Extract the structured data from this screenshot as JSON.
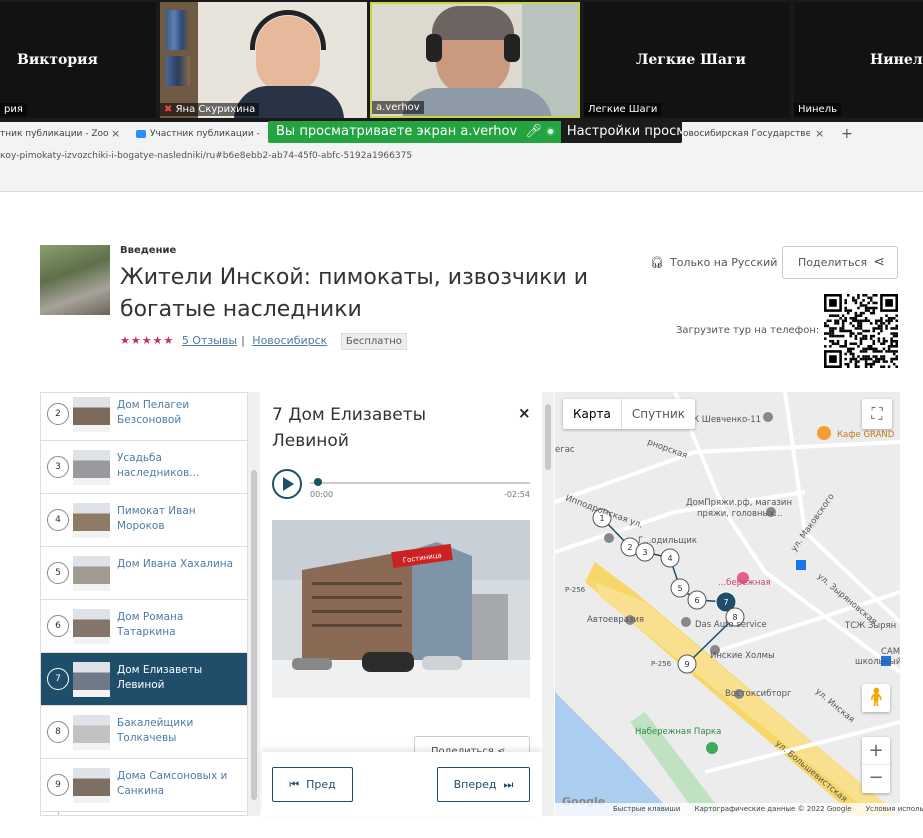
{
  "zoom": {
    "participants": [
      {
        "name": "Виктория",
        "label": "рия"
      },
      {
        "name": "",
        "label": "Яна Скурихина"
      },
      {
        "name": "",
        "label": "a.verhov"
      },
      {
        "name": "Легкие Шаги",
        "label": "Легкие Шаги"
      },
      {
        "name": "Нинель",
        "label": "Нинель"
      }
    ],
    "banner_text": "Вы просматриваете экран a.verhov",
    "banner_settings": "Настройки просмотра"
  },
  "browser": {
    "tabs": [
      "тник публикации - Zoom",
      "Участник публикации - Zoom",
      "овосибирская Государственн"
    ],
    "close": "×",
    "newtab": "+",
    "url": "коу-pimokaty-izvozchiki-i-bogatye-nasledniki/ru#b6e8ebb2-ab74-45f0-abfc-5192a1966375"
  },
  "tour": {
    "section": "Введение",
    "title": "Жители Инской: пимокаты, извозчики и богатые наследники",
    "stars": "★★★★★",
    "reviews": "5 Отзывы",
    "separator": "|",
    "city": "Новосибирск",
    "price": "Бесплатно",
    "language": "Только на Русский",
    "share": "Поделиться",
    "download_label": "Загрузите тур на телефон:"
  },
  "stops": [
    {
      "num": "2",
      "label": "Дом Пелагеи Безсоновой",
      "color": "#7c6a5a"
    },
    {
      "num": "3",
      "label": "Усадьба наследников...",
      "color": "#9a9a9e"
    },
    {
      "num": "4",
      "label": "Пимокат Иван Мороков",
      "color": "#8d7b63"
    },
    {
      "num": "5",
      "label": "Дом Ивана Хахалина",
      "color": "#a09a90"
    },
    {
      "num": "6",
      "label": "Дом Романа Татаркина",
      "color": "#85756a"
    },
    {
      "num": "7",
      "label": "Дом Елизаветы Левиной",
      "color": "#6e7a86",
      "active": true
    },
    {
      "num": "8",
      "label": "Бакалейщики Толкачевы",
      "color": "#c2c2c2"
    },
    {
      "num": "9",
      "label": "Дома Самсоновых и Санкина",
      "color": "#7d6f62"
    }
  ],
  "detail": {
    "title": "7 Дом Елизаветы Левиной",
    "close": "×",
    "time_start": "00:00",
    "time_end": "-02:54",
    "progress": 0.02,
    "photo_sign": "Гостиница",
    "share": "Поделиться",
    "prev": "Пред",
    "next": "Вперед"
  },
  "map": {
    "type_map": "Карта",
    "type_satellite": "Спутник",
    "zoom_in": "+",
    "zoom_out": "−",
    "fullscreen": "⛶",
    "google": "Google",
    "attribution": [
      "Быстрые клавиши",
      "Картографические данные © 2022 Google",
      "Условия использования"
    ],
    "labels": {
      "shevchenko": "К Шевченко-11",
      "cafe": "Кафе GRAND",
      "rnaya": "рнорская",
      "egas": "егас",
      "ippodrom": "Ипподромская ул.",
      "dompryazhi1": "ДомПряжи.рф, магазин",
      "dompryazhi2": "пряжи, головных...",
      "makovskogo": "ул. Маковского",
      "zyryanovskaya": "ул. Зыряновская",
      "gosadovodstvo": "Г...одильщик",
      "berezhnaya": "...бережная",
      "r256a": "Р-256",
      "avtoevrazia": "Автоевразия",
      "dasauto": "Das Auto service",
      "tszh": "ТСЖ Зырян",
      "cam1": "САМ",
      "cam2": "школьный мар",
      "r256b": "Р-256",
      "inskie": "Инские Холмы",
      "inskaya": "ул. Инская",
      "vostok": "Востоксибторг",
      "nabpark": "Набережная Парка",
      "bolshev": "ул. Большевистская"
    },
    "route_points": [
      "1",
      "2",
      "3",
      "4",
      "5",
      "6",
      "7",
      "8",
      "9"
    ]
  }
}
